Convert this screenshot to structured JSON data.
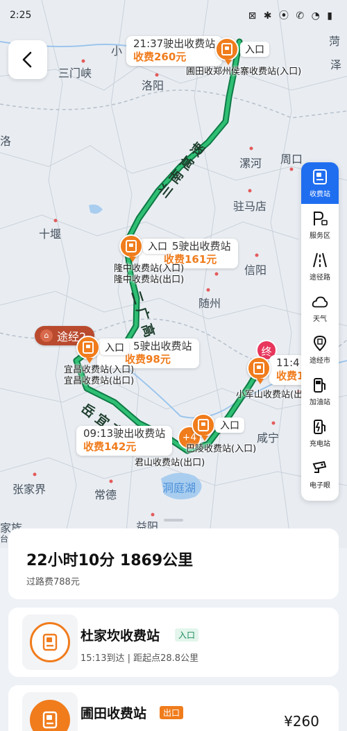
{
  "status_bar": {
    "time": "2:25",
    "icons": "⊠ ✱ ⦿ ✆ ◔ ▮"
  },
  "map": {
    "cities": [
      {
        "name": "三门峡"
      },
      {
        "name": "洛阳"
      },
      {
        "name": "漯河"
      },
      {
        "name": "周口"
      },
      {
        "name": "驻马店"
      },
      {
        "name": "十堰"
      },
      {
        "name": "信阳"
      },
      {
        "name": "随州"
      },
      {
        "name": "咸宁"
      },
      {
        "name": "张家界"
      },
      {
        "name": "常德"
      },
      {
        "name": "洞庭湖"
      },
      {
        "name": "益阳"
      },
      {
        "name": "小"
      },
      {
        "name": "菏"
      },
      {
        "name": "泽"
      },
      {
        "name": "洛"
      },
      {
        "name": "家族"
      },
      {
        "name": "台州"
      }
    ],
    "roads": [
      {
        "name": "兰南高速"
      },
      {
        "name": "二广高速"
      },
      {
        "name": "岳宜高速"
      }
    ],
    "toll_tags": [
      {
        "time": "21:37驶出收费站",
        "fee": "收费260元",
        "entry": "入口",
        "station": "圃田收郑州侯寨收费站(入口)"
      },
      {
        "time": "5驶出收费站",
        "fee": "收费161元",
        "entry": "入口",
        "station": "隆中收费站(入口)\n隆中收费站(出口)"
      },
      {
        "time": "5驶出收费站",
        "fee": "收费98元",
        "entry": "入口",
        "station": "宜昌收费站(入口)\n宜昌收费站(出口)"
      },
      {
        "time": "09:13驶出收费站",
        "fee": "收费142元",
        "entry": "入口",
        "station": "巴陵收费站(入口)"
      },
      {
        "time": "11:4",
        "fee": "收费1",
        "entry": "",
        "station": "小军山收费站(出"
      }
    ],
    "extra_station": "君山收费站(出口)",
    "via_label": "途经2",
    "end_label": "终",
    "cluster_label": "+4"
  },
  "side_panel": [
    {
      "label": "收费站",
      "icon": "toll-station-icon",
      "active": true
    },
    {
      "label": "服务区",
      "icon": "service-area-icon",
      "active": false
    },
    {
      "label": "途径路",
      "icon": "route-road-icon",
      "active": false
    },
    {
      "label": "天气",
      "icon": "weather-icon",
      "active": false
    },
    {
      "label": "途经市",
      "icon": "city-pin-icon",
      "active": false
    },
    {
      "label": "加油站",
      "icon": "gas-station-icon",
      "active": false
    },
    {
      "label": "充电站",
      "icon": "charging-station-icon",
      "active": false
    },
    {
      "label": "电子眼",
      "icon": "camera-icon",
      "active": false
    }
  ],
  "summary": {
    "duration_distance": "22小时10分  1869公里",
    "toll_total": "过路费788元"
  },
  "stations": [
    {
      "name": "杜家坎收费站",
      "badge": "入口",
      "badge_type": "in",
      "detail": "15:13到达 | 距起点28.8公里",
      "price": ""
    },
    {
      "name": "圃田收费站",
      "badge": "出口",
      "badge_type": "out",
      "detail": "",
      "price": "¥260"
    }
  ],
  "colors": {
    "accent": "#1f6ef0",
    "toll_orange": "#f07c1c",
    "route_green": "#1fa15c"
  }
}
